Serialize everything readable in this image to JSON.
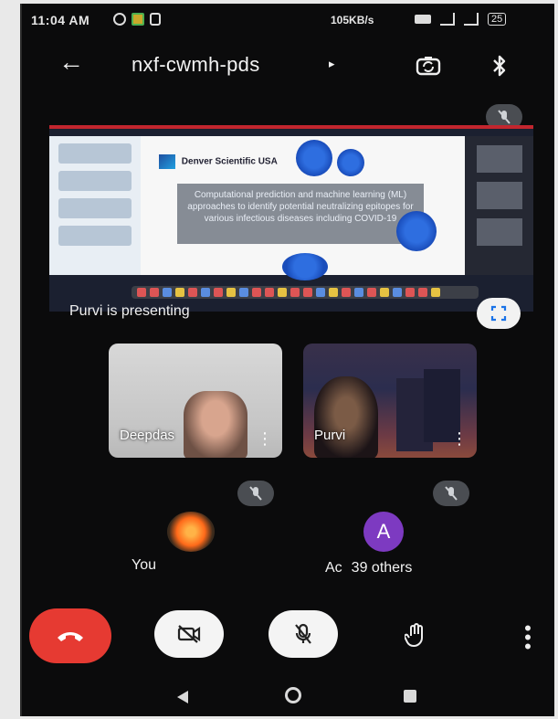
{
  "status_bar": {
    "time": "11:04 AM",
    "network_speed": "105KB/s",
    "battery": "25"
  },
  "header": {
    "meeting_code": "nxf-cwmh-pds",
    "chevron": "▸"
  },
  "presentation": {
    "slide_org": "Denver Scientific USA",
    "slide_text": "Computational prediction and machine learning (ML) approaches to identify potential neutralizing epitopes for various infectious diseases including COVID-19",
    "presenting_label": "Purvi is presenting"
  },
  "tiles": [
    {
      "name": "Deepdas"
    },
    {
      "name": "Purvi"
    }
  ],
  "participants": {
    "self_label": "You",
    "avatar_initial": "A",
    "others_prefix": "Ac",
    "others_count": "39 others"
  },
  "icons": {
    "back": "arrow-left-icon",
    "camera_switch": "switch-camera-icon",
    "bluetooth": "bluetooth-icon",
    "mic_muted": "mic-off-icon",
    "fullscreen": "fullscreen-icon",
    "end_call": "phone-hangup-icon",
    "video_off": "video-off-icon",
    "raise_hand": "hand-icon",
    "more": "more-vert-icon"
  },
  "colors": {
    "end_call": "#e63a32",
    "avatar": "#7d3ac1",
    "accent_red": "#c2262e"
  }
}
